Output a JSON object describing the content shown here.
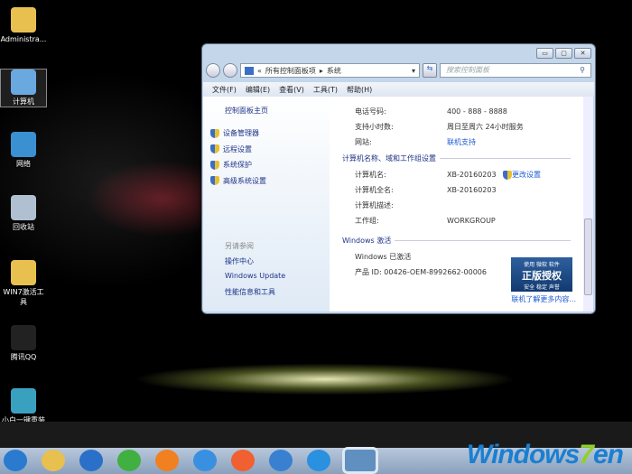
{
  "desktop": {
    "icons": [
      {
        "label": "Administra...",
        "color": "#e8c050"
      },
      {
        "label": "计算机",
        "color": "#6aa8e0"
      },
      {
        "label": "网络",
        "color": "#3a90d0"
      },
      {
        "label": "回收站",
        "color": "#b0c0d0"
      },
      {
        "label": "WIN7激活工具",
        "color": "#e8c050"
      },
      {
        "label": "腾讯QQ",
        "color": "#222"
      },
      {
        "label": "小白一键重装系统",
        "color": "#3aa0c0"
      }
    ]
  },
  "window": {
    "controls": [
      "▭",
      "▢",
      "✕"
    ],
    "breadcrumb": [
      "«",
      "所有控制面板项",
      "▸",
      "系统"
    ],
    "search_placeholder": "搜索控制面板",
    "menu": [
      "文件(F)",
      "编辑(E)",
      "查看(V)",
      "工具(T)",
      "帮助(H)"
    ],
    "left": {
      "home": "控制面板主页",
      "tasks": [
        "设备管理器",
        "远程设置",
        "系统保护",
        "高级系统设置"
      ],
      "see_also": "另请参阅",
      "links": [
        "操作中心",
        "Windows Update",
        "性能信息和工具"
      ]
    },
    "support": [
      {
        "k": "电话号码:",
        "v": "400 - 888 - 8888"
      },
      {
        "k": "支持小时数:",
        "v": "周日至周六  24小时服务"
      },
      {
        "k": "网站:",
        "v": "联机支持",
        "link": true
      }
    ],
    "computer_section": "计算机名称、域和工作组设置",
    "computer": [
      {
        "k": "计算机名:",
        "v": "XB-20160203"
      },
      {
        "k": "计算机全名:",
        "v": "XB-20160203"
      },
      {
        "k": "计算机描述:",
        "v": ""
      },
      {
        "k": "工作组:",
        "v": "WORKGROUP"
      }
    ],
    "change_settings": "更改设置",
    "activation_section": "Windows 激活",
    "activated": "Windows 已激活",
    "product_id": "产品 ID: 00426-OEM-8992662-00006",
    "badge": {
      "top": "使用 微软 软件",
      "main": "正版授权",
      "bottom": "安全 稳定 声誉"
    },
    "more_link": "联机了解更多内容..."
  },
  "taskbar": {
    "items": [
      "start",
      "explorer",
      "ie",
      "360-browser",
      "uc-browser",
      "qq-browser",
      "liebao-browser",
      "ie-alt",
      "safari-like",
      "control-panel"
    ],
    "colors": [
      "#2a7ad0",
      "#e8c050",
      "#2a70c8",
      "#40b040",
      "#f08020",
      "#3a90e0",
      "#f06030",
      "#3a80d0",
      "#2a90e0",
      "#6090c0"
    ]
  },
  "watermark": {
    "text": "Windows7en",
    "domain": ".com"
  }
}
